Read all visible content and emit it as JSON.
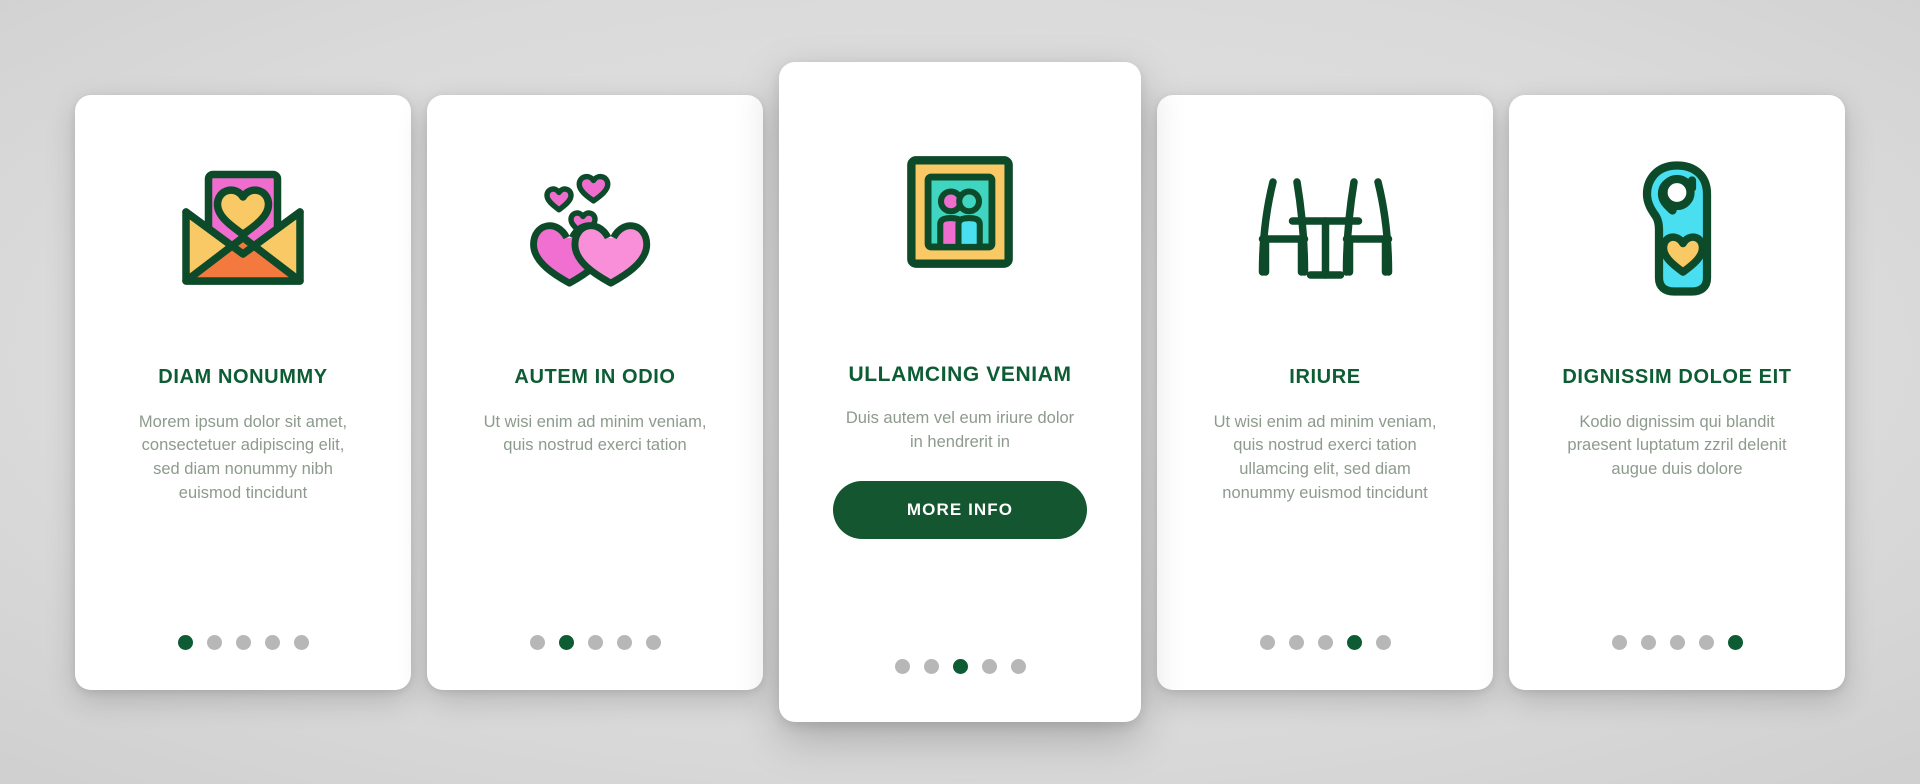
{
  "theme": {
    "green_dark": "#0d5c33",
    "green_button": "#13562f",
    "body_text": "#8d9a8d",
    "dot_inactive": "#b7b7b7",
    "card_bg": "#ffffff",
    "page_bg": "#d6d6d6",
    "accent_pink": "#ef6dcf",
    "accent_magenta": "#f06fd0",
    "accent_yellow": "#f8c964",
    "accent_orange": "#f4793f",
    "accent_teal": "#3fd5c0",
    "accent_cyan": "#49dff0",
    "accent_pink_light": "#f98fd8"
  },
  "cards": [
    {
      "id": "card-1",
      "icon": "envelope-heart-icon",
      "title": "DIAM NONUMMY",
      "body": "Morem ipsum dolor sit amet, consectetuer adipiscing elit, sed diam nonummy nibh euismod tincidunt",
      "dots_total": 5,
      "dot_active": 1,
      "featured": false,
      "button": null
    },
    {
      "id": "card-2",
      "icon": "two-hearts-icon",
      "title": "AUTEM IN ODIO",
      "body": "Ut wisi enim ad minim veniam, quis nostrud exerci tation",
      "dots_total": 5,
      "dot_active": 2,
      "featured": false,
      "button": null
    },
    {
      "id": "card-3",
      "icon": "couple-photo-frame-icon",
      "title": "ULLAMCING VENIAM",
      "body": "Duis autem vel eum iriure dolor in hendrerit in",
      "dots_total": 5,
      "dot_active": 3,
      "featured": true,
      "button": "MORE INFO"
    },
    {
      "id": "card-4",
      "icon": "table-chairs-icon",
      "title": "IRIURE",
      "body": "Ut wisi enim ad minim veniam, quis nostrud exerci tation ullamcing elit, sed diam nonummy euismod tincidunt",
      "dots_total": 5,
      "dot_active": 4,
      "featured": false,
      "button": null
    },
    {
      "id": "card-5",
      "icon": "door-hanger-heart-icon",
      "title": "DIGNISSIM DOLOE EIT",
      "body": "Kodio dignissim qui blandit praesent luptatum zzril delenit augue duis dolore",
      "dots_total": 5,
      "dot_active": 5,
      "featured": false,
      "button": null
    }
  ]
}
